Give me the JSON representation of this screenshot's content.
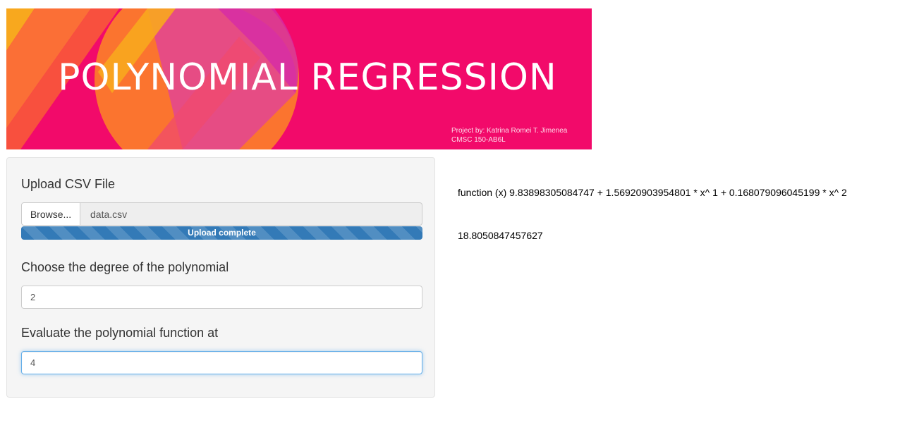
{
  "banner": {
    "title": "POLYNOMIAL REGRESSION",
    "credit_line1": "Project by:  Katrina Romei T. Jimenea",
    "credit_line2": "CMSC 150-AB6L",
    "colors": {
      "background": "#f20a6a",
      "orange": "#fb7a2c",
      "yellow": "#f8a81e",
      "magenta": "#d934a4"
    }
  },
  "sidebar": {
    "upload": {
      "label": "Upload CSV File",
      "browse_label": "Browse...",
      "file_name": "data.csv",
      "progress_text": "Upload complete",
      "progress_fraction": 1.0
    },
    "degree": {
      "label": "Choose the degree of the polynomial",
      "value": "2"
    },
    "evaluate": {
      "label": "Evaluate the polynomial function at",
      "value": "4"
    }
  },
  "output": {
    "function_text": "function (x) 9.83898305084747 + 1.56920903954801 * x^ 1 + 0.168079096045199 * x^ 2",
    "result_text": "18.8050847457627"
  },
  "colors": {
    "accent": "#337ab7",
    "focus": "#66afe9"
  }
}
